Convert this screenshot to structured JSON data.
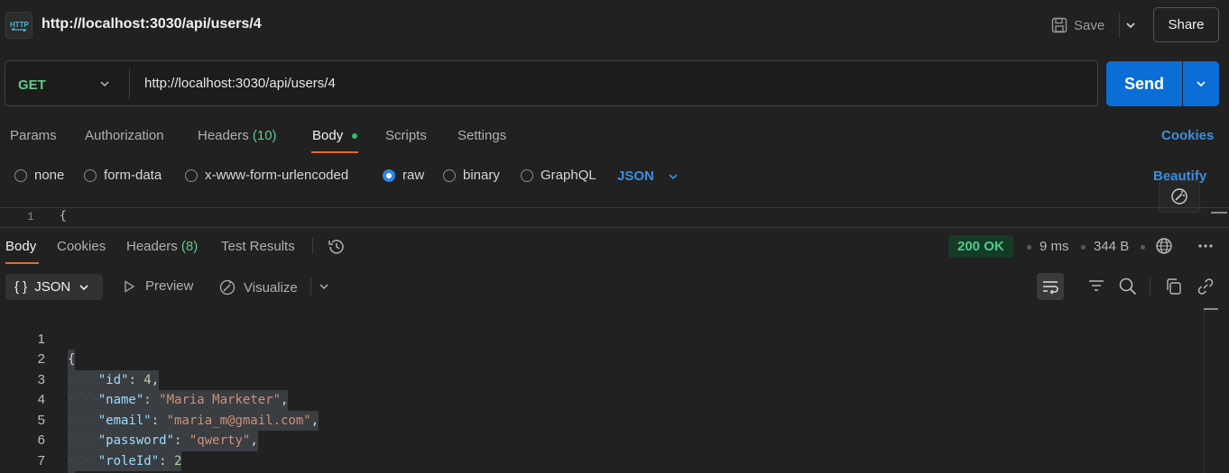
{
  "header": {
    "title": "http://localhost:3030/api/users/4",
    "save_label": "Save",
    "share_label": "Share"
  },
  "request": {
    "method": "GET",
    "url": "http://localhost:3030/api/users/4",
    "send_label": "Send"
  },
  "request_tabs": {
    "params": "Params",
    "authorization": "Authorization",
    "headers": "Headers",
    "headers_count": "(10)",
    "body": "Body",
    "scripts": "Scripts",
    "settings": "Settings",
    "cookies": "Cookies",
    "active": "Body"
  },
  "body_modes": {
    "none": "none",
    "form_data": "form-data",
    "urlencoded": "x-www-form-urlencoded",
    "raw": "raw",
    "binary": "binary",
    "graphql": "GraphQL",
    "selected": "raw",
    "language": "JSON",
    "beautify": "Beautify"
  },
  "request_editor": {
    "line_number": "1",
    "first_char": "{"
  },
  "response_tabs": {
    "body": "Body",
    "cookies": "Cookies",
    "headers": "Headers",
    "headers_count": "(8)",
    "test_results": "Test Results",
    "active": "Body"
  },
  "response_meta": {
    "status": "200 OK",
    "time": "9 ms",
    "size": "344 B"
  },
  "response_toolbar": {
    "format": "JSON",
    "format_icon": "{ }",
    "preview": "Preview",
    "visualize": "Visualize"
  },
  "response_body": {
    "line_numbers": [
      "1",
      "2",
      "3",
      "4",
      "5",
      "6",
      "7"
    ],
    "open_brace": "{",
    "close_brace": "}",
    "id_key": "\"id\"",
    "id_value": "4",
    "name_key": "\"name\"",
    "name_value": "\"Maria Marketer\"",
    "email_key": "\"email\"",
    "email_value": "\"maria_m@gmail.com\"",
    "password_key": "\"password\"",
    "password_value": "\"qwerty\"",
    "roleId_key": "\"roleId\"",
    "roleId_value": "2"
  },
  "colors": {
    "accent_blue": "#0b6dd6",
    "method_green": "#61c98c",
    "active_tab_orange": "#e36b2c",
    "status_green": "#52c98a"
  }
}
